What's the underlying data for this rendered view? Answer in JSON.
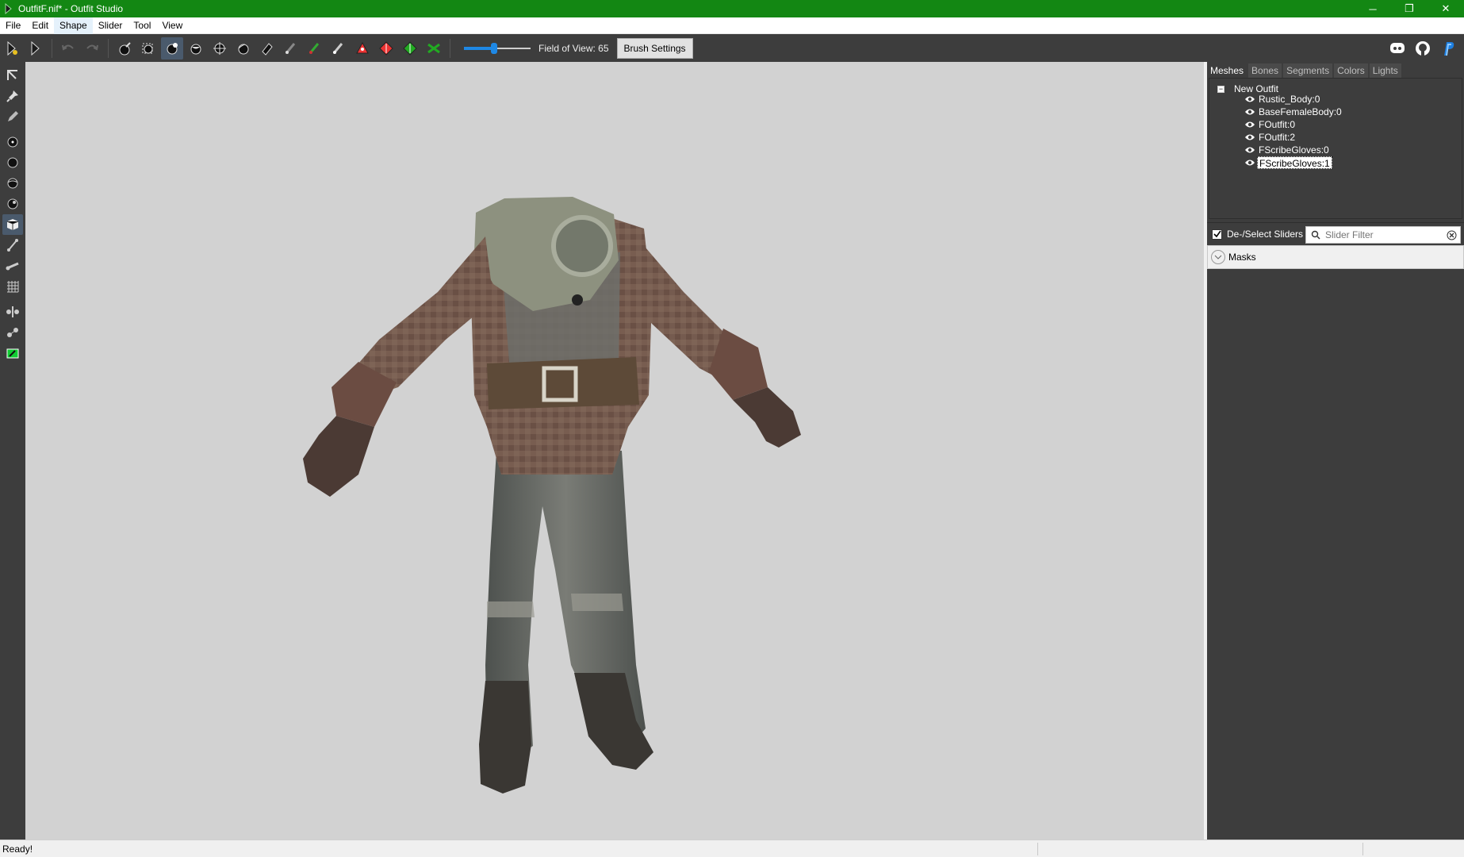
{
  "window": {
    "title": "OutfitF.nif* - Outfit Studio",
    "minimize_glyph": "─",
    "restore_glyph": "❐",
    "close_glyph": "✕"
  },
  "menu": [
    "File",
    "Edit",
    "Shape",
    "Slider",
    "Tool",
    "View"
  ],
  "toolbar": {
    "fov_label": "Field of View: 65",
    "fov_value": 65,
    "fov_fill_fraction": 0.45,
    "brush_settings_label": "Brush Settings"
  },
  "panel": {
    "tabs": [
      "Meshes",
      "Bones",
      "Segments",
      "Colors",
      "Lights"
    ],
    "active_tab": "Meshes",
    "tree_root": "New Outfit",
    "tree_expander": "−",
    "meshes": [
      "Rustic_Body:0",
      "BaseFemaleBody:0",
      "FOutfit:0",
      "FOutfit:2",
      "FScribeGloves:0",
      "FScribeGloves:1"
    ],
    "selected_mesh": "FScribeGloves:1",
    "deselect_label": "De-/Select Sliders",
    "deselect_checked": true,
    "filter_placeholder": "Slider Filter",
    "masks_label": "Masks"
  },
  "status": {
    "text": "Ready!"
  },
  "colors": {
    "titlebar": "#138713",
    "toolbar": "#3d3d3d",
    "viewport": "#d2d2d2",
    "accent": "#1e88e5"
  }
}
